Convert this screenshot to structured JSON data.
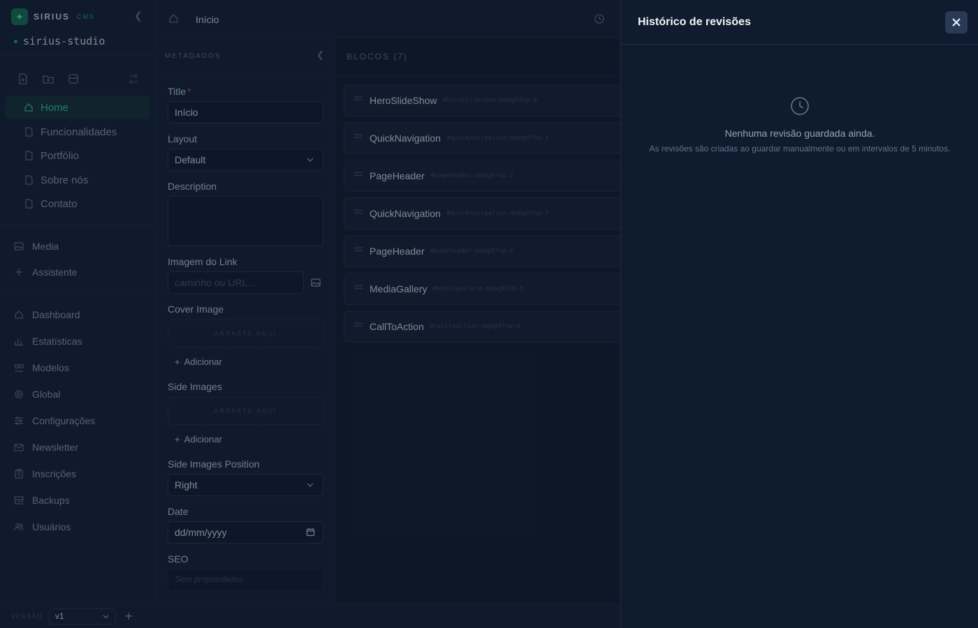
{
  "brand": {
    "name": "SIRIUS",
    "tag": "CMS"
  },
  "project": "sirius-studio",
  "pages": [
    {
      "label": "Home",
      "active": true
    },
    {
      "label": "Funcionalidades",
      "active": false
    },
    {
      "label": "Portfólio",
      "active": false
    },
    {
      "label": "Sobre nós",
      "active": false
    },
    {
      "label": "Contato",
      "active": false
    }
  ],
  "nav_top": [
    {
      "label": "Media",
      "icon": "image-icon"
    },
    {
      "label": "Assistente",
      "icon": "plus-icon"
    }
  ],
  "nav_bottom": [
    {
      "label": "Dashboard",
      "icon": "home-icon"
    },
    {
      "label": "Estatísticas",
      "icon": "chart-icon"
    },
    {
      "label": "Modelos",
      "icon": "template-icon"
    },
    {
      "label": "Global",
      "icon": "gear-icon"
    },
    {
      "label": "Configurações",
      "icon": "sliders-icon"
    },
    {
      "label": "Newsletter",
      "icon": "mail-icon"
    },
    {
      "label": "Inscrições",
      "icon": "clipboard-icon"
    },
    {
      "label": "Backups",
      "icon": "archive-icon"
    },
    {
      "label": "Usuários",
      "icon": "users-icon"
    }
  ],
  "topbar": {
    "breadcrumb": "Início"
  },
  "metadata": {
    "heading": "METADADOS",
    "title_label": "Title",
    "title_required": "*",
    "title_value": "Início",
    "layout_label": "Layout",
    "layout_value": "Default",
    "description_label": "Description",
    "description_value": "",
    "link_image_label": "Imagem do Link",
    "link_image_placeholder": "caminho ou URL...",
    "cover_label": "Cover Image",
    "dropzone_text": "ARRASTE AQUI",
    "add_label": "Adicionar",
    "side_images_label": "Side Images",
    "side_position_label": "Side Images Position",
    "side_position_value": "Right",
    "date_label": "Date",
    "date_placeholder": "dd/mm/yyyy",
    "seo_label": "SEO",
    "seo_empty": "Sem propriedades"
  },
  "blocks": {
    "heading": "BLOCOS (7)",
    "items": [
      {
        "name": "HeroSlideShow",
        "id": "#heroslideshow-mqbg97np-0"
      },
      {
        "name": "QuickNavigation",
        "id": "#quicknavigation-mqbg97np-1"
      },
      {
        "name": "PageHeader",
        "id": "#pageheader-mqbg97np-2"
      },
      {
        "name": "QuickNavigation",
        "id": "#quicknavigation-mqbg97np-3"
      },
      {
        "name": "PageHeader",
        "id": "#pageheader-mqbg97np-4"
      },
      {
        "name": "MediaGallery",
        "id": "#mediagallery-mqbg97np-5"
      },
      {
        "name": "CallToAction",
        "id": "#calltoaction-mqbg97np-6"
      }
    ]
  },
  "footer": {
    "version_label": "VERSÃO",
    "version_value": "v1"
  },
  "drawer": {
    "title": "Histórico de revisões",
    "empty_title": "Nenhuma revisão guardada ainda.",
    "empty_subtitle": "As revisões são criadas ao guardar manualmente ou em intervalos de 5 minutos."
  },
  "colors": {
    "accent": "#10b981",
    "background": "#0f1a2b",
    "drawer": "#0f1b2e"
  }
}
